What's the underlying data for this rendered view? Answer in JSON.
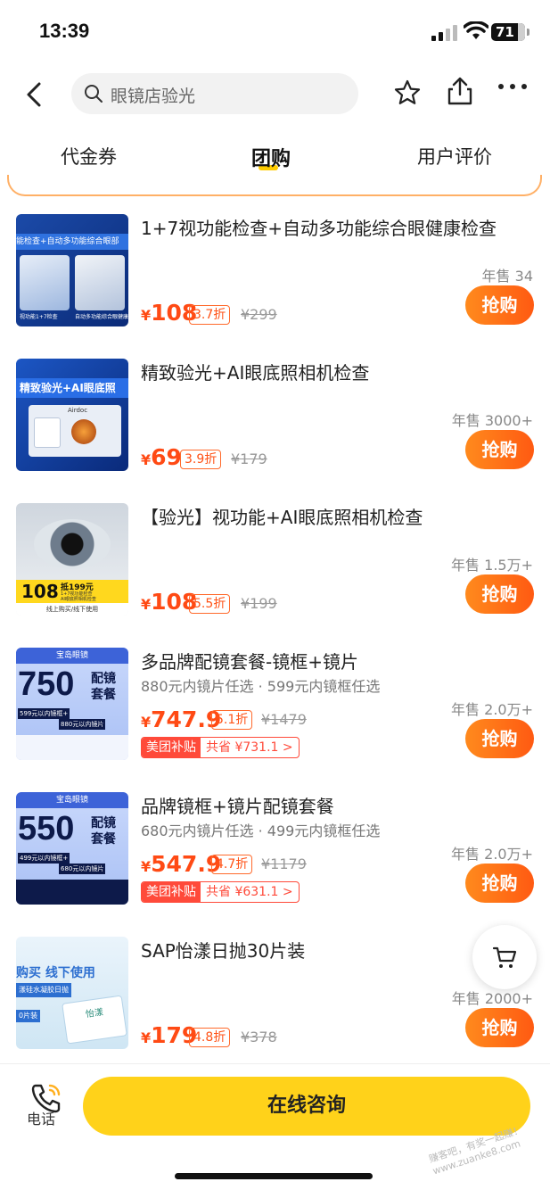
{
  "status": {
    "time": "13:39",
    "battery": "71"
  },
  "nav": {
    "search_placeholder": "眼镜店验光"
  },
  "tabs": [
    "代金券",
    "团购",
    "用户评价"
  ],
  "items": [
    {
      "title": "1+7视功能检查+自动多功能综合眼健康检查",
      "sub": "",
      "yen": "¥",
      "price": "108",
      "discount": "3.7折",
      "orig": "¥299",
      "sold": "年售 34",
      "buy": "抢购",
      "subsidy": null
    },
    {
      "title": "精致验光+AI眼底照相机检查",
      "sub": "",
      "yen": "¥",
      "price": "69",
      "discount": "3.9折",
      "orig": "¥179",
      "sold": "年售 3000+",
      "buy": "抢购",
      "subsidy": null
    },
    {
      "title": "【验光】视功能+AI眼底照相机检查",
      "sub": "",
      "yen": "¥",
      "price": "108",
      "discount": "5.5折",
      "orig": "¥199",
      "sold": "年售 1.5万+",
      "buy": "抢购",
      "subsidy": null
    },
    {
      "title": "多品牌配镜套餐-镜框+镜片",
      "sub": "880元内镜片任选 · 599元内镜框任选",
      "yen": "¥",
      "price": "747.9",
      "discount": "5.1折",
      "orig": "¥1479",
      "sold": "年售 2.0万+",
      "buy": "抢购",
      "subsidy": {
        "label": "美团补贴",
        "save": "共省 ¥731.1 >"
      }
    },
    {
      "title": "品牌镜框+镜片配镜套餐",
      "sub": "680元内镜片任选 · 499元内镜框任选",
      "yen": "¥",
      "price": "547.9",
      "discount": "4.7折",
      "orig": "¥1179",
      "sold": "年售 2.0万+",
      "buy": "抢购",
      "subsidy": {
        "label": "美团补贴",
        "save": "共省 ¥631.1 >"
      }
    },
    {
      "title": "SAP怡漾日抛30片装",
      "sub": "",
      "yen": "¥",
      "price": "179",
      "discount": "4.8折",
      "orig": "¥378",
      "sold": "年售 2000+",
      "buy": "抢购",
      "subsidy": null
    }
  ],
  "thumbs": [
    {
      "banner": "能检查+自动多功能综合眼部",
      "caption_l": "视功能1+7检查",
      "caption_r": "自动多功能综合眼健康检查"
    },
    {
      "banner": "精致验光+AI眼底照",
      "brand": "Airdoc"
    },
    {
      "price": "108",
      "note": "抵199元",
      "sub": "1+7视功能检查",
      "sub2": "AI眼底照相机检查",
      "bottom": "线上购买/线下使用"
    },
    {
      "shop": "宝岛眼镜",
      "big": "750",
      "tag1": "配镜",
      "tag2": "套餐",
      "line1": "599元以内镜框+",
      "line2": "880元以内镜片"
    },
    {
      "shop": "宝岛眼镜",
      "big": "550",
      "tag1": "配镜",
      "tag2": "套餐",
      "line1": "499元以内镜框+",
      "line2": "680元以内镜片"
    },
    {
      "top": "购买 线下使用",
      "mid": "漾硅水凝胶日抛",
      "small": "0片装",
      "box": "怡漾"
    }
  ],
  "bottom": {
    "phone_label": "电话",
    "consult_label": "在线咨询"
  },
  "watermark": "赚客吧，有奖一起赚！www.zuanke8.com",
  "colors": {
    "accent": "#ff5a12",
    "consult": "#ffd21a",
    "tab_underline": "#ffcc00"
  }
}
